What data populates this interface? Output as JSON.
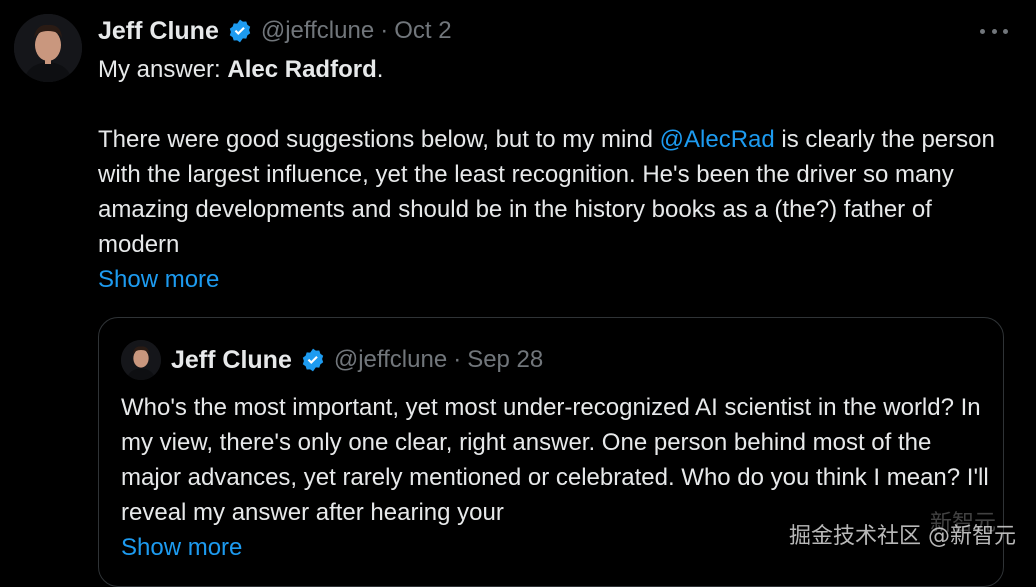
{
  "tweet": {
    "author_name": "Jeff Clune",
    "handle": "@jeffclune",
    "separator": "·",
    "date": "Oct 2",
    "answer_prefix": "My answer: ",
    "answer_name": "Alec Radford",
    "answer_suffix": ".",
    "text_before_mention": "There were good suggestions below, but to my mind ",
    "mention": "@AlecRad",
    "text_after_mention": " is clearly the person with the largest influence, yet the least recognition. He's been the driver so many amazing developments and should be in the history books as a (the?) father of modern",
    "show_more": "Show more",
    "more_icon": "more-horizontal-icon",
    "verified_icon": "verified-badge-icon"
  },
  "quoted_tweet": {
    "author_name": "Jeff Clune",
    "handle": "@jeffclune",
    "separator": "·",
    "date": "Sep 28",
    "text": "Who's the most important, yet most under-recognized AI scientist in the world? In my view, there's only one clear, right answer. One person behind most of the major advances, yet rarely mentioned or celebrated. Who do you think I mean? I'll reveal my answer after hearing your",
    "show_more": "Show more"
  },
  "watermark": {
    "text": "掘金技术社区 @新智元",
    "background_text": "新智元"
  },
  "colors": {
    "background": "#000000",
    "text": "#e7e9ea",
    "secondary": "#71767b",
    "accent": "#1d9bf0",
    "border": "#2f3336"
  }
}
